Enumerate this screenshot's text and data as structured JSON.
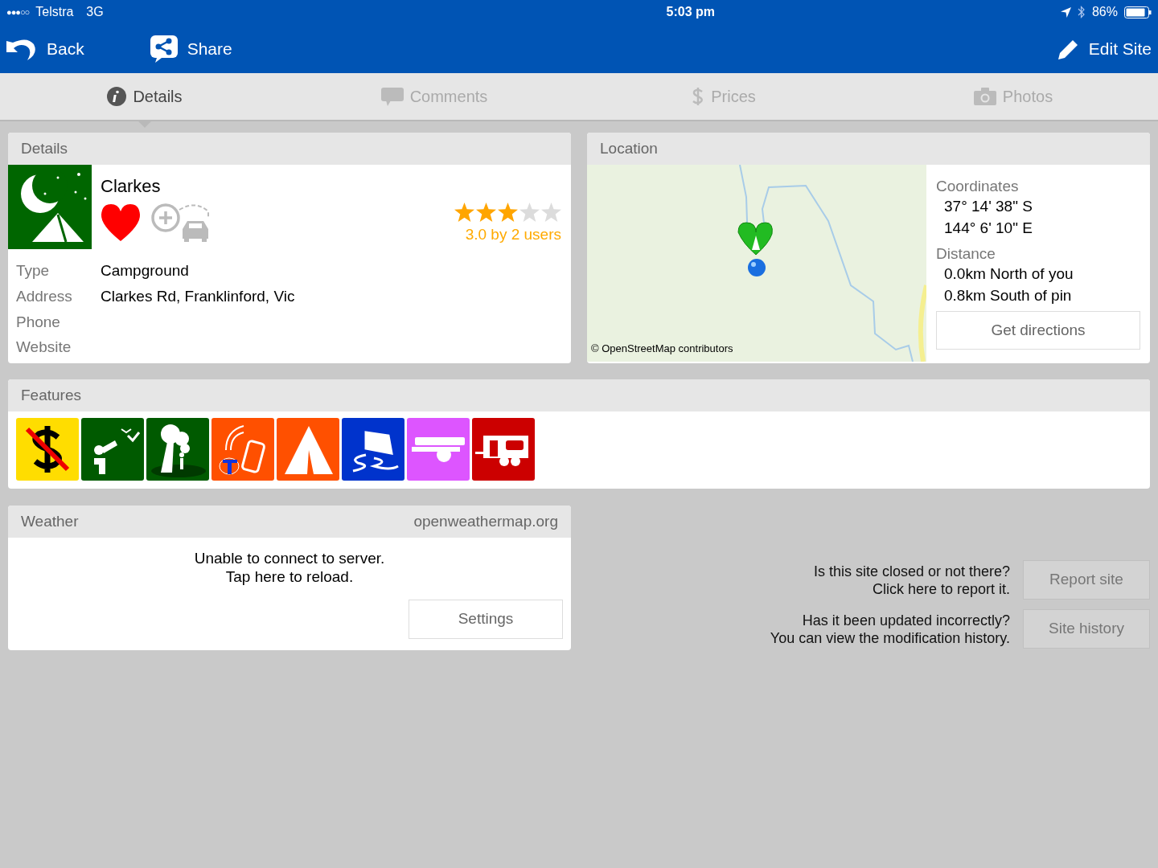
{
  "status_bar": {
    "signal": "●●●○○",
    "carrier": "Telstra",
    "network": "3G",
    "time": "5:03 pm",
    "battery": "86%"
  },
  "nav": {
    "back": "Back",
    "share": "Share",
    "edit": "Edit Site"
  },
  "tabs": [
    {
      "label": "Details",
      "selected": true
    },
    {
      "label": "Comments",
      "selected": false
    },
    {
      "label": "Prices",
      "selected": false
    },
    {
      "label": "Photos",
      "selected": false
    }
  ],
  "details": {
    "header": "Details",
    "name": "Clarkes",
    "favorite": true,
    "stars": 3,
    "rating": "3.0 by 2 users",
    "fields": [
      {
        "label": "Type",
        "value": "Campground"
      },
      {
        "label": "Address",
        "value": "Clarkes Rd, Franklinford, Vic"
      },
      {
        "label": "Phone"
      },
      {
        "label": "Website"
      }
    ]
  },
  "location": {
    "header": "Location",
    "map": {
      "attribution": "© OpenStreetMap contributors"
    },
    "coordinates_label": "Coordinates",
    "latitude": "37° 14' 38\" S",
    "longitude": "144° 6' 10\" E",
    "distance_label": "Distance",
    "distance_you": "0.0km North of you",
    "distance_pin": "0.8km South of pin",
    "directions_button": "Get directions"
  },
  "features": {
    "header": "Features",
    "items": [
      {
        "kind": "no-fee",
        "color": "#ffdd00"
      },
      {
        "kind": "birdwatching",
        "color": "#005a00"
      },
      {
        "kind": "shade",
        "color": "#005a00"
      },
      {
        "kind": "phone-reception",
        "color": "#ff5000"
      },
      {
        "kind": "tent",
        "color": "#ff5000"
      },
      {
        "kind": "offroad",
        "color": "#0033cc"
      },
      {
        "kind": "trailer",
        "color": "#dd55ff"
      },
      {
        "kind": "caravan",
        "color": "#cc0000"
      }
    ]
  },
  "weather": {
    "header": "Weather",
    "source": "openweathermap.org",
    "message_1": "Unable to connect to server.",
    "message_2": "Tap here to reload.",
    "settings_button": "Settings"
  },
  "report": [
    {
      "line_1": "Is this site closed or not there?",
      "line_2": "Click here to report it.",
      "button": "Report site"
    },
    {
      "line_1": "Has it been updated incorrectly?",
      "line_2": "You can view the modification history.",
      "button": "Site history"
    }
  ]
}
